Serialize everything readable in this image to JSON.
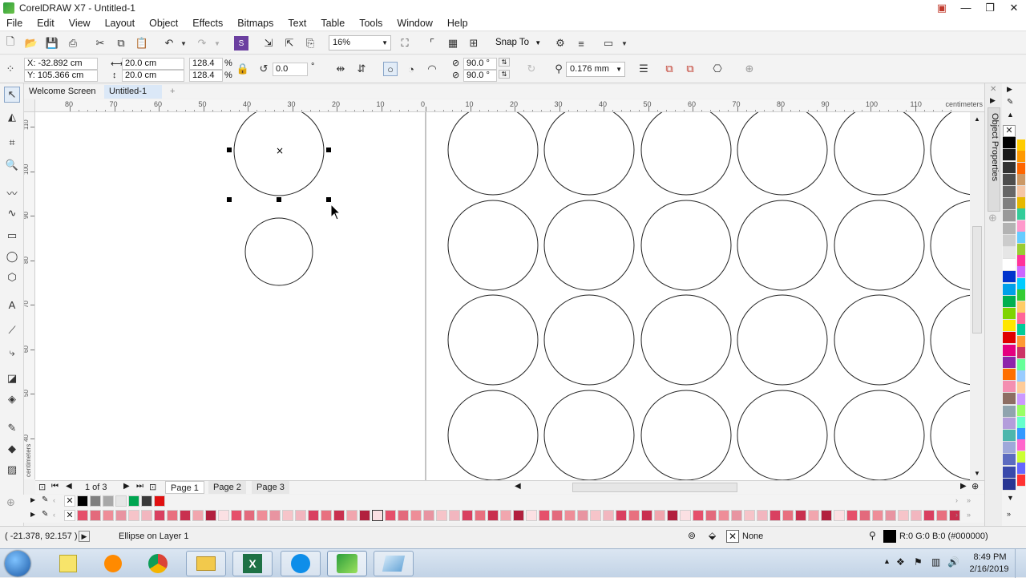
{
  "window": {
    "title": "CorelDRAW X7 - Untitled-1",
    "min": "—",
    "max": "❐",
    "close": "✕"
  },
  "menu": [
    "File",
    "Edit",
    "View",
    "Layout",
    "Object",
    "Effects",
    "Bitmaps",
    "Text",
    "Table",
    "Tools",
    "Window",
    "Help"
  ],
  "standard_bar": {
    "zoom": "16%",
    "snap_to": "Snap To"
  },
  "property_bar": {
    "x": "X: -32.892 cm",
    "y": "Y: 105.366 cm",
    "width": "20.0 cm",
    "height": "20.0 cm",
    "scale_x": "128.4",
    "scale_y": "128.4",
    "percent": "%",
    "rotation": "0.0",
    "degree": "°",
    "angle_start": "90.0 °",
    "angle_end": "90.0 °",
    "outline_width": "0.176 mm"
  },
  "doc_tabs": {
    "welcome": "Welcome Screen",
    "active": "Untitled-1",
    "add": "+"
  },
  "ruler": {
    "h_ticks": [
      "80",
      "70",
      "60",
      "50",
      "40",
      "30",
      "20",
      "10",
      "0",
      "10",
      "20",
      "30",
      "40",
      "50",
      "60",
      "70",
      "80",
      "90",
      "100",
      "110"
    ],
    "h_unit": "centimeters",
    "v_ticks": [
      "110",
      "100",
      "90",
      "80",
      "70",
      "60",
      "50",
      "40"
    ],
    "v_unit": "centimeters"
  },
  "page_nav": {
    "count": "1 of 3",
    "pages": [
      "Page 1",
      "Page 2",
      "Page 3"
    ]
  },
  "status": {
    "coords": "( -21.378, 92.157 )",
    "object": "Ellipse on Layer 1",
    "fill": "None",
    "outline": "R:0 G:0 B:0 (#000000)"
  },
  "taskbar": {
    "time": "8:49 PM",
    "date": "2/16/2019"
  },
  "right_panel": {
    "label": "Object Properties"
  },
  "colors": {
    "accent": "#2c9e3c",
    "tab_active": "#dbe8f7",
    "selection": "#000000"
  }
}
